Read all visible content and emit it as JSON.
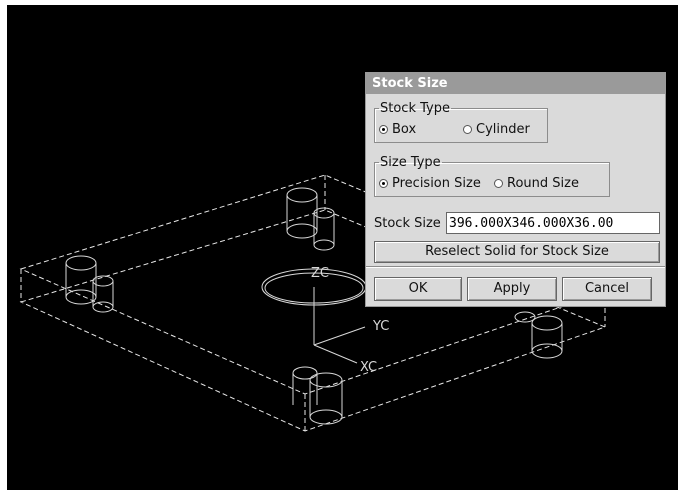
{
  "dialog": {
    "title": "Stock Size",
    "stock_type": {
      "legend": "Stock Type",
      "options": [
        "Box",
        "Cylinder"
      ],
      "selected": "Box"
    },
    "size_type": {
      "legend": "Size Type",
      "options": [
        "Precision Size",
        "Round Size"
      ],
      "selected": "Precision Size"
    },
    "stock_size_label": "Stock Size",
    "stock_size_value": "396.000X346.000X36.00",
    "reselect_label": "Reselect Solid for Stock Size",
    "ok_label": "OK",
    "apply_label": "Apply",
    "cancel_label": "Cancel"
  },
  "viewport": {
    "background": "#000000",
    "axis_labels": {
      "z": "ZC",
      "y": "YC",
      "x": "XC"
    }
  }
}
